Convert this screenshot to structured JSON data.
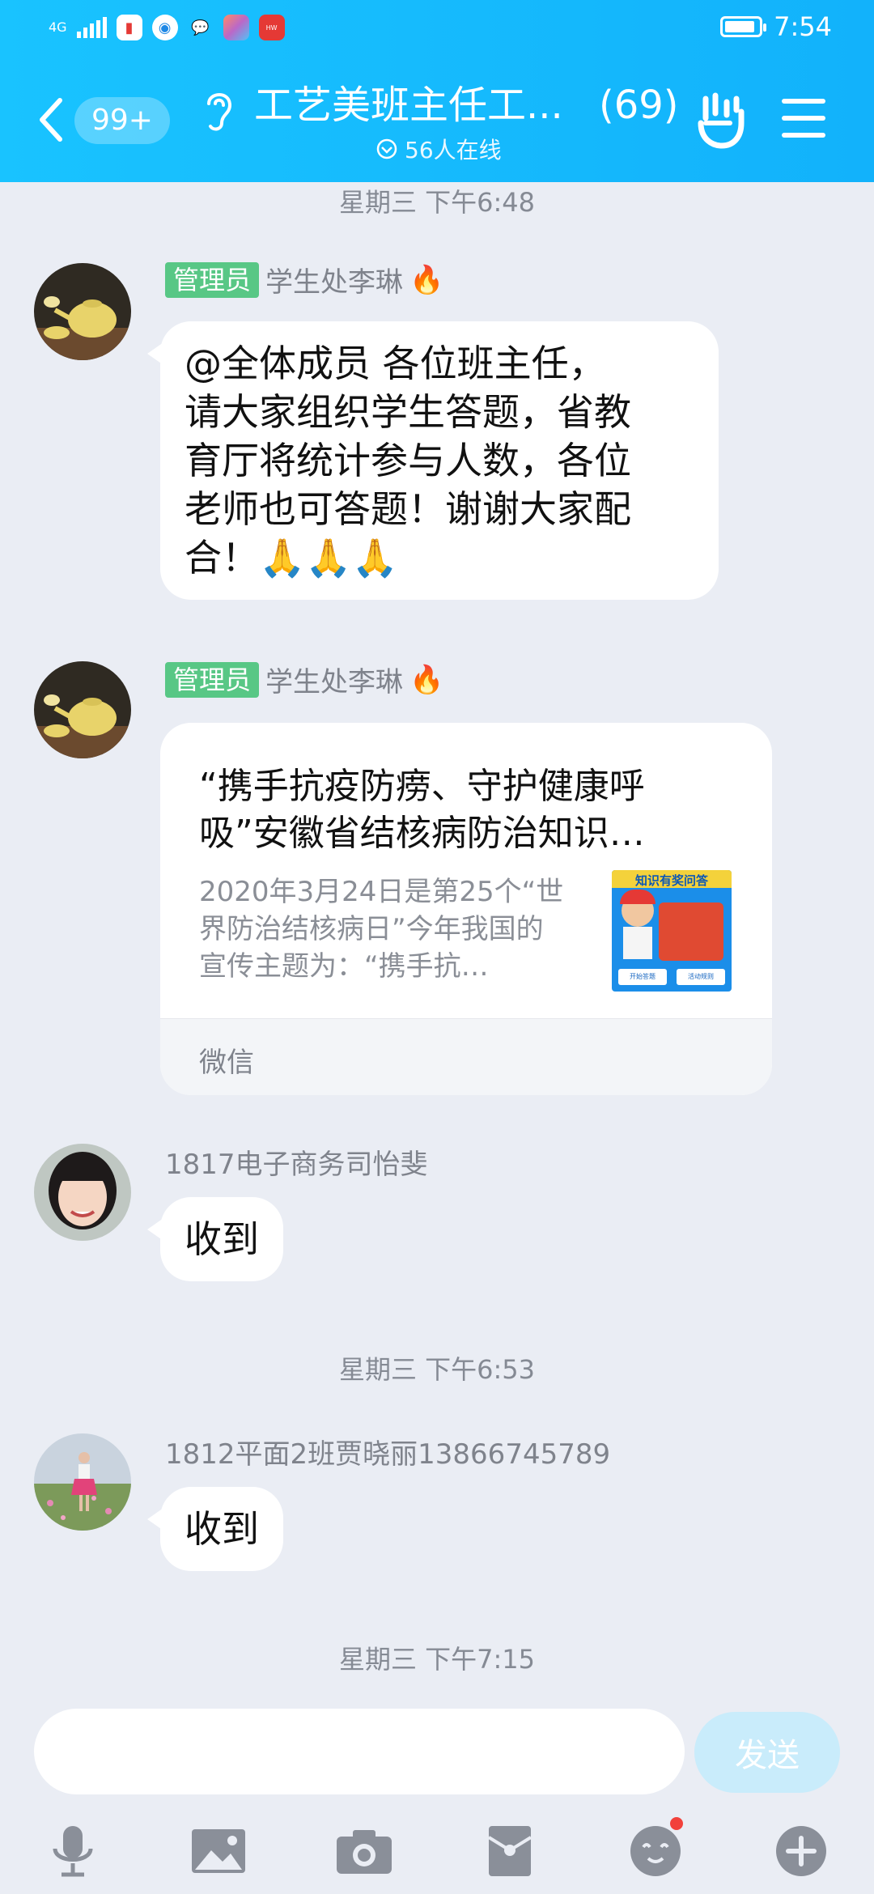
{
  "status_bar": {
    "network": "4G",
    "time": "7:54",
    "battery_level": 0.9
  },
  "header": {
    "unread_count": "99+",
    "title": "工艺美班主任工...",
    "member_count": "(69)",
    "online_status": "56人在线"
  },
  "messages": [
    {
      "timestamp": "星期三 下午6:48",
      "role": "管理员",
      "sender": "学生处李琳",
      "text": "@全体成员 各位班主任，\n请大家组织学生答题，省教\n育厅将统计参与人数，各位\n老师也可答题！谢谢大家配\n合！🙏🙏🙏"
    },
    {
      "role": "管理员",
      "sender": "学生处李琳",
      "card": {
        "title": "“携手抗疫防痨、守护健康呼\n吸”安徽省结核病防治知识…",
        "description": "2020年3月24日是第25个“世\n界防治结核病日”今年我国的\n宣传主题为：“携手抗…",
        "thumb_label": "知识有奖问答",
        "thumb_btn_left": "开始答题",
        "thumb_btn_right": "活动规则",
        "source": "微信"
      }
    },
    {
      "sender": "1817电子商务司怡斐",
      "text": "收到"
    },
    {
      "timestamp": "星期三 下午6:53",
      "sender": "1812平面2班贾晓丽13866745789",
      "text": "收到"
    },
    {
      "timestamp": "星期三 下午7:15"
    }
  ],
  "input": {
    "value": "",
    "send_label": "发送"
  },
  "toolbar": [
    "microphone-icon",
    "image-icon",
    "camera-icon",
    "red-packet-icon",
    "emoji-icon",
    "plus-icon"
  ],
  "colors": {
    "header": "#12b2fb",
    "background": "#eaedf4",
    "admin_tag": "#58c785",
    "send_button": "#c9ecfb"
  }
}
